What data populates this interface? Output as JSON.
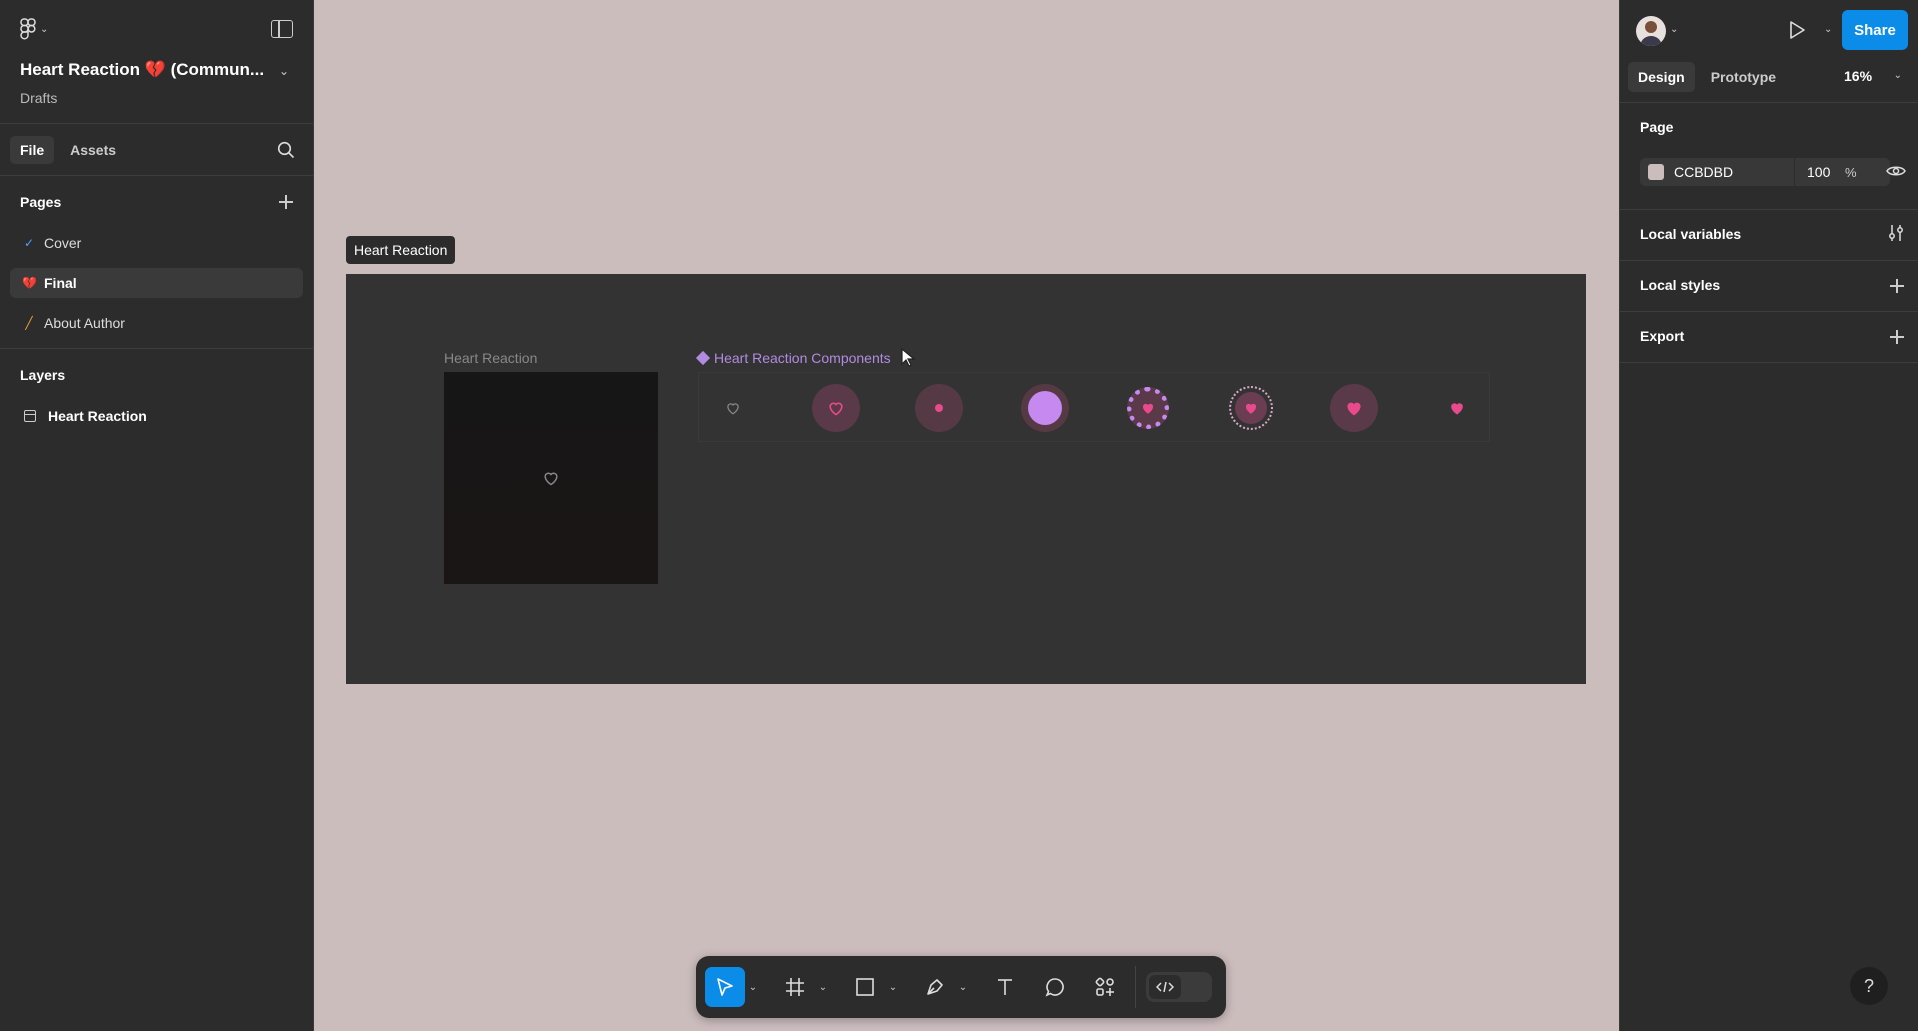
{
  "file": {
    "title": "Heart Reaction 💔 (Commun...",
    "location": "Drafts"
  },
  "left_tabs": [
    "File",
    "Assets"
  ],
  "pages": {
    "heading": "Pages",
    "items": [
      {
        "icon": "✓",
        "label": "Cover",
        "icon_color": "#4aa3ff"
      },
      {
        "icon": "💔",
        "label": "Final",
        "icon_color": "#e34b6b"
      },
      {
        "icon": "╱",
        "label": "About Author",
        "icon_color": "#f0a33a"
      }
    ]
  },
  "layers": {
    "heading": "Layers",
    "items": [
      {
        "label": "Heart Reaction",
        "icon": "frame-icon"
      }
    ]
  },
  "canvas": {
    "background": "#ccbdbd",
    "frame_label": "Heart Reaction",
    "preview_label": "Heart Reaction",
    "components_label": "Heart Reaction Components"
  },
  "right": {
    "share_label": "Share",
    "tabs": [
      "Design",
      "Prototype"
    ],
    "zoom": "16%",
    "page_heading": "Page",
    "page_color": "CCBDBD",
    "page_opacity": "100",
    "page_opacity_unit": "%",
    "local_variables": "Local variables",
    "local_styles": "Local styles",
    "export": "Export",
    "help": "?"
  },
  "colors": {
    "accent": "#0c8ce9",
    "heart_pink": "#e84a8c",
    "component_purple": "#b18be0"
  }
}
